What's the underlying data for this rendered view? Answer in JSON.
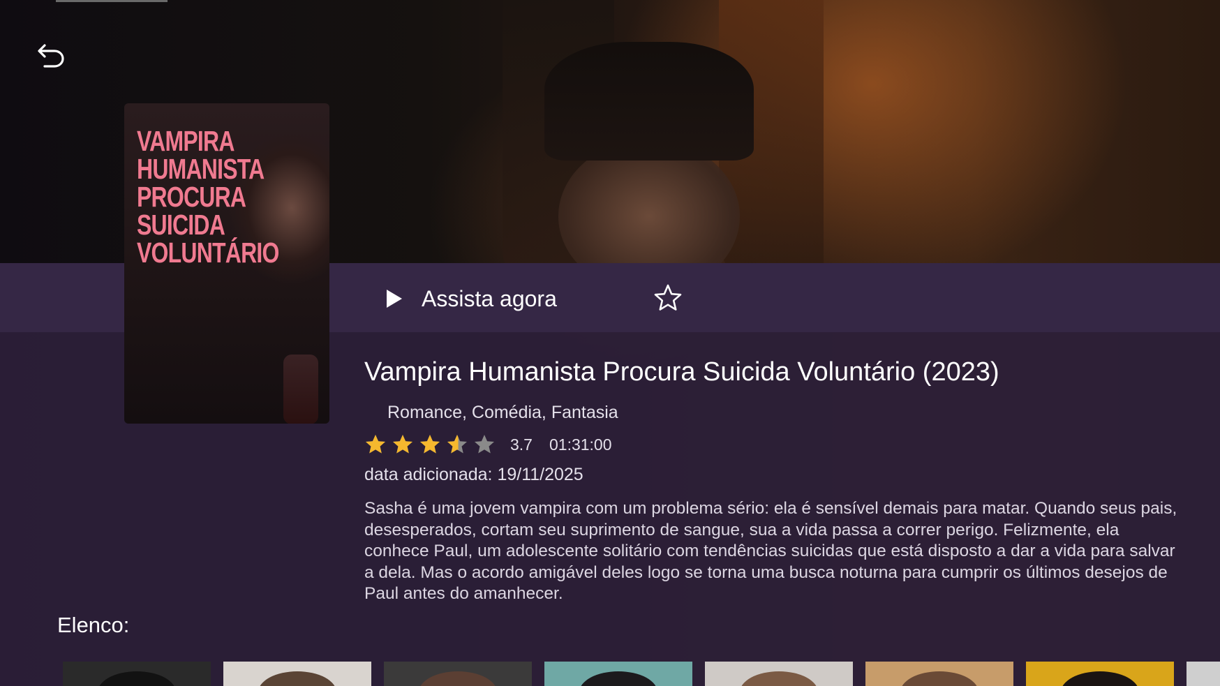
{
  "navigation": {
    "back_icon": "back-arrow-icon"
  },
  "poster": {
    "title_lines": [
      "Vampira",
      "Humanista",
      "Procura",
      "Suicida",
      "Voluntário"
    ]
  },
  "actions": {
    "play_label": "Assista agora",
    "play_icon": "play-icon",
    "favorite_icon": "star-outline-icon"
  },
  "movie": {
    "title": "Vampira Humanista Procura Suicida Voluntário (2023)",
    "genres": "Romance, Comédia, Fantasia",
    "rating": "3.7",
    "rating_value": 3.7,
    "rating_max": 5,
    "duration": "01:31:00",
    "date_added_label": "data adicionada:",
    "date_added": "19/11/2025",
    "synopsis": "Sasha é uma jovem vampira com um problema sério: ela é sensível demais para matar. Quando seus pais, desesperados, cortam seu suprimento de sangue, sua a vida passa a correr perigo. Felizmente, ela conhece Paul, um adolescente solitário com tendências suicidas que está disposto a dar a vida para salvar a dela. Mas o acordo amigável deles logo se torna uma busca noturna para cumprir os últimos desejos de Paul antes do amanhecer."
  },
  "cast": {
    "heading": "Elenco:",
    "card_colors": [
      [
        "#2a2a2a",
        "#121212"
      ],
      [
        "#d9d4cf",
        "#5a4435"
      ],
      [
        "#3b3a3a",
        "#5b3f33"
      ],
      [
        "#6fa8a5",
        "#1c1a1d"
      ],
      [
        "#cfcac6",
        "#7b5a44"
      ],
      [
        "#c79c6a",
        "#6a4a36"
      ],
      [
        "#d9a51a",
        "#1a1412"
      ],
      [
        "#cfcfcf",
        "#9a9a9a"
      ]
    ]
  },
  "colors": {
    "panel": "#2c203a",
    "accent_star": "#f5b82e",
    "star_empty": "#8a8a8a"
  }
}
